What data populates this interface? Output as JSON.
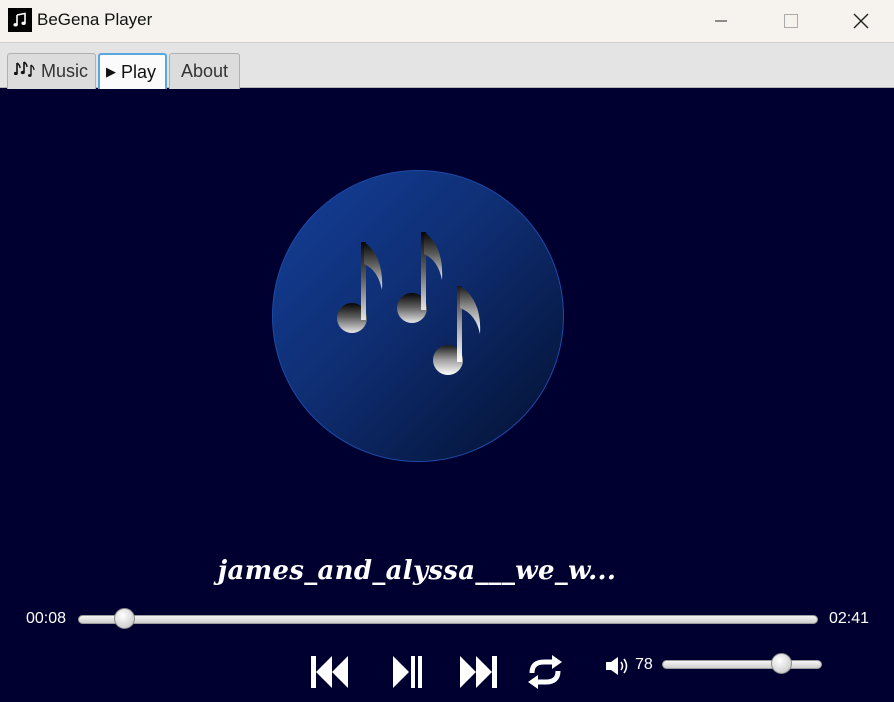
{
  "window": {
    "title": "BeGena Player",
    "controls": [
      "minimize-icon",
      "maximize-icon",
      "close-icon"
    ]
  },
  "tabs": [
    {
      "icon": "music-notes-icon",
      "label": "Music",
      "selected": false
    },
    {
      "icon": "play-icon",
      "label": "Play",
      "selected": true
    },
    {
      "icon": "",
      "label": "About",
      "selected": false
    }
  ],
  "player": {
    "album_art_icon": "music-notes-icon",
    "song_title": "james_and_alyssa___we_w...",
    "elapsed": "00:08",
    "total": "02:41",
    "progress": 0.05,
    "controls": [
      "previous-icon",
      "play-pause-icon",
      "next-icon",
      "repeat-icon"
    ],
    "volume_icon": "speaker-icon",
    "volume": "78",
    "volume_level": 0.78
  },
  "colors": {
    "background": "#000030",
    "album_gradient_start": "#143f99",
    "album_gradient_end": "#031030",
    "tab_focus": "#5aa7dd",
    "text": "#ffffff"
  }
}
